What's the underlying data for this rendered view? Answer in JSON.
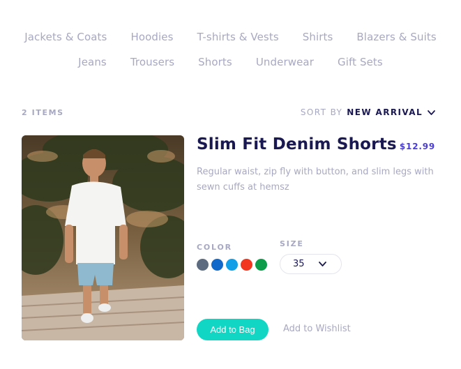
{
  "categories_row1": [
    "Jackets & Coats",
    "Hoodies",
    "T-shirts & Vests",
    "Shirts",
    "Blazers & Suits"
  ],
  "categories_row2": [
    "Jeans",
    "Trousers",
    "Shorts",
    "Underwear",
    "Gift Sets"
  ],
  "listing": {
    "items_count": "2 ITEMS",
    "sort_label": "SORT BY",
    "sort_value": "NEW ARRIVAL"
  },
  "product": {
    "title": "Slim Fit Denim Shorts",
    "price": "$12.99",
    "description": "Regular waist, zip fly with button, and slim legs with sewn cuffs at hemsz",
    "color_label": "COLOR",
    "size_label": "SIZE",
    "size_value": "35",
    "colors": [
      "#5d6b80",
      "#1369c9",
      "#11a0e8",
      "#f2351f",
      "#0d9d4a"
    ],
    "add_to_bag": "Add to Bag",
    "add_to_wishlist": "Add to Wishlist"
  }
}
